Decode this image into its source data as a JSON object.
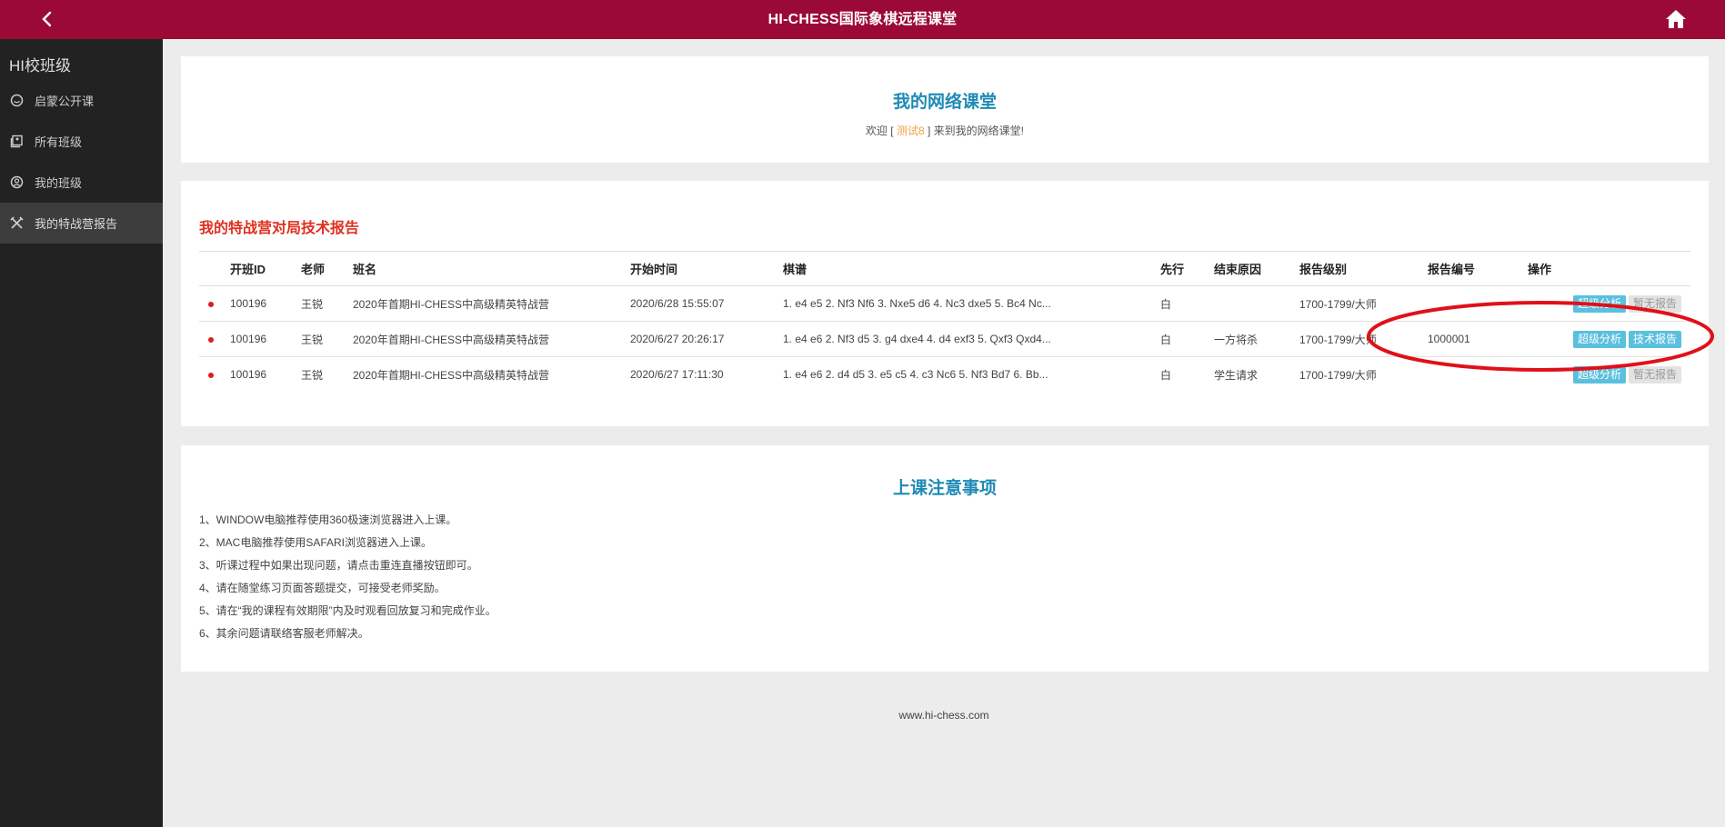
{
  "header": {
    "title": "HI-CHESS国际象棋远程课堂",
    "back_icon": "chevron-left-icon",
    "home_icon": "home-icon"
  },
  "sidebar": {
    "brand": "HI校班级",
    "items": [
      {
        "label": "启蒙公开课",
        "icon": "smile-circle-icon"
      },
      {
        "label": "所有班级",
        "icon": "portrait-frame-icon"
      },
      {
        "label": "我的班级",
        "icon": "user-circle-icon"
      },
      {
        "label": "我的特战营报告",
        "icon": "crossed-swords-icon",
        "active": true
      }
    ]
  },
  "welcome": {
    "title": "我的网络课堂",
    "prefix": "欢迎 [ ",
    "user": "测试8",
    "suffix": " ] 来到我的网络课堂!"
  },
  "reports": {
    "title": "我的特战营对局技术报告",
    "columns": [
      "开班ID",
      "老师",
      "班名",
      "开始时间",
      "棋谱",
      "先行",
      "结束原因",
      "报告级别",
      "报告编号",
      "操作"
    ],
    "rows": [
      {
        "class_id": "100196",
        "teacher": "王锐",
        "class_name": "2020年首期HI-CHESS中高级精英特战营",
        "start_time": "2020/6/28 15:55:07",
        "moves": "1. e4 e5 2. Nf3 Nf6 3. Nxe5 d6 4. Nc3 dxe5 5. Bc4 Nc...",
        "first": "白",
        "end_reason": "",
        "level": "1700-1799/大师",
        "report_no": "",
        "btn1": "超级分析",
        "btn2": "暂无报告"
      },
      {
        "class_id": "100196",
        "teacher": "王锐",
        "class_name": "2020年首期HI-CHESS中高级精英特战营",
        "start_time": "2020/6/27 20:26:17",
        "moves": "1. e4 e6 2. Nf3 d5 3. g4 dxe4 4. d4 exf3 5. Qxf3 Qxd4...",
        "first": "白",
        "end_reason": "一方将杀",
        "level": "1700-1799/大师",
        "report_no": "1000001",
        "btn1": "超级分析",
        "btn2": "技术报告"
      },
      {
        "class_id": "100196",
        "teacher": "王锐",
        "class_name": "2020年首期HI-CHESS中高级精英特战营",
        "start_time": "2020/6/27 17:11:30",
        "moves": "1. e4 e6 2. d4 d5 3. e5 c5 4. c3 Nc6 5. Nf3 Bd7 6. Bb...",
        "first": "白",
        "end_reason": "学生请求",
        "level": "1700-1799/大师",
        "report_no": "",
        "btn1": "超级分析",
        "btn2": "暂无报告"
      }
    ]
  },
  "notes": {
    "title": "上课注意事项",
    "items": [
      "1、WINDOW电脑推荐使用360极速浏览器进入上课。",
      "2、MAC电脑推荐使用SAFARI浏览器进入上课。",
      "3、听课过程中如果出现问题，请点击重连直播按钮即可。",
      "4、请在随堂练习页面答题提交，可接受老师奖励。",
      "5、请在“我的课程有效期限”内及时观看回放复习和完成作业。",
      "6、其余问题请联络客服老师解决。"
    ]
  },
  "footer": {
    "text": "www.hi-chess.com"
  },
  "colors": {
    "header_bg": "#9b0a36",
    "sidebar_bg": "#222222",
    "title_blue": "#1f8ab5",
    "report_red": "#e03020",
    "button_blue": "#5bc0de",
    "annotation_red": "#e0101a"
  }
}
